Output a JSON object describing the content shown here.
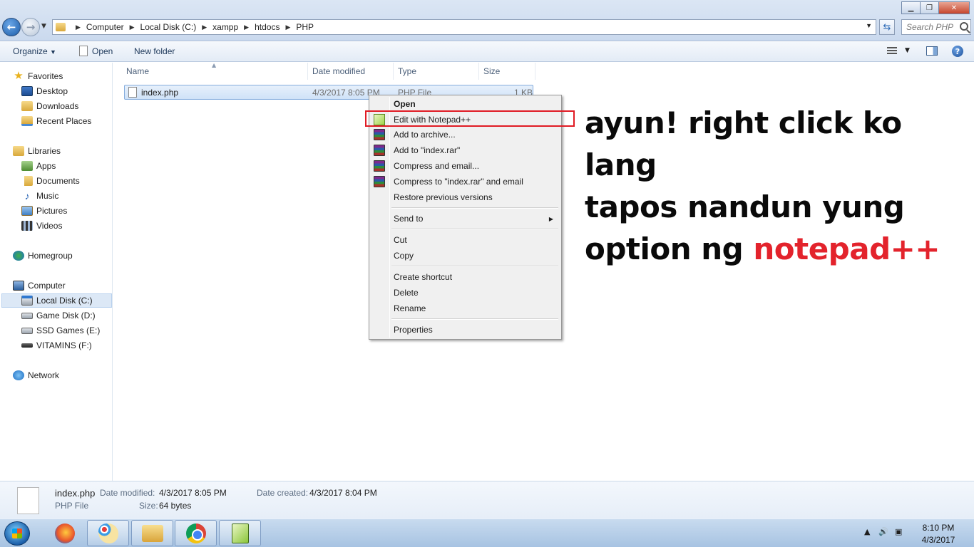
{
  "window": {
    "minimize_icon": "minimize-icon",
    "maximize_icon": "restore-icon",
    "close_icon": "close-icon"
  },
  "address": {
    "crumbs": [
      "Computer",
      "Local Disk (C:)",
      "xampp",
      "htdocs",
      "PHP"
    ],
    "search_placeholder": "Search PHP"
  },
  "toolbar": {
    "organize": "Organize",
    "open": "Open",
    "new_folder": "New folder"
  },
  "sidebar": {
    "favorites": "Favorites",
    "desktop": "Desktop",
    "downloads": "Downloads",
    "recent_places": "Recent Places",
    "libraries": "Libraries",
    "apps": "Apps",
    "documents": "Documents",
    "music": "Music",
    "pictures": "Pictures",
    "videos": "Videos",
    "homegroup": "Homegroup",
    "computer": "Computer",
    "local_disk": "Local Disk (C:)",
    "game_disk": "Game Disk (D:)",
    "ssd_games": "SSD Games (E:)",
    "vitamins": "VITAMINS (F:)",
    "network": "Network"
  },
  "columns": {
    "name": "Name",
    "date_modified": "Date modified",
    "type": "Type",
    "size": "Size"
  },
  "files": [
    {
      "name": "index.php",
      "date_modified": "4/3/2017 8:05 PM",
      "type": "PHP File",
      "size": "1 KB"
    }
  ],
  "context_menu": {
    "open": "Open",
    "edit_npp": "Edit with Notepad++",
    "add_archive": "Add to archive...",
    "add_rar": "Add to \"index.rar\"",
    "compress_email": "Compress and email...",
    "compress_rar_email": "Compress to \"index.rar\" and email",
    "restore": "Restore previous versions",
    "send_to": "Send to",
    "cut": "Cut",
    "copy": "Copy",
    "create_shortcut": "Create shortcut",
    "delete": "Delete",
    "rename": "Rename",
    "properties": "Properties"
  },
  "annotation": {
    "line1": "ayun! right click ko lang",
    "line2": "tapos nandun yung",
    "line3_prefix": "option ng ",
    "line3_highlight": "notepad++"
  },
  "details": {
    "filename": "index.php",
    "date_modified_label": "Date modified:",
    "date_modified_value": "4/3/2017 8:05 PM",
    "date_created_label": "Date created:",
    "date_created_value": "4/3/2017 8:04 PM",
    "type": "PHP File",
    "size_label": "Size:",
    "size_value": "64 bytes"
  },
  "taskbar": {
    "apps": [
      "firefox-icon",
      "paint-icon",
      "windows-explorer-icon",
      "chrome-icon",
      "notepad-plus-plus-icon"
    ],
    "time": "8:10 PM",
    "date": "4/3/2017"
  },
  "colors": {
    "highlight_box": "#e01b24",
    "annotation_red": "#e3232c"
  }
}
